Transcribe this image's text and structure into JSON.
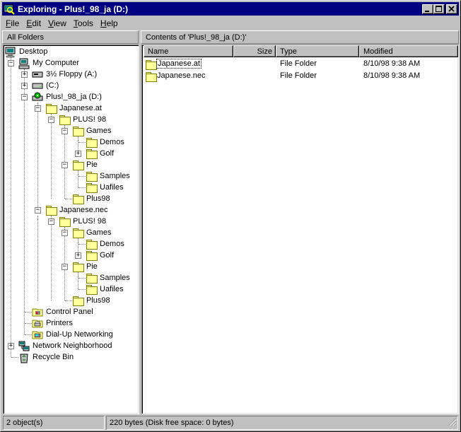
{
  "window": {
    "title": "Exploring - Plus!_98_ja (D:)",
    "accent_color": "#000080"
  },
  "menubar": {
    "items": [
      {
        "underline": "F",
        "rest": "ile"
      },
      {
        "underline": "E",
        "rest": "dit"
      },
      {
        "underline": "V",
        "rest": "iew"
      },
      {
        "underline": "T",
        "rest": "ools"
      },
      {
        "underline": "H",
        "rest": "elp"
      }
    ]
  },
  "left_pane": {
    "header": "All Folders",
    "tree": [
      {
        "label": "Desktop",
        "icon": "desktop-icon"
      },
      {
        "label": "My Computer",
        "icon": "computer-icon"
      },
      {
        "label": "3½ Floppy (A:)",
        "icon": "floppy-icon"
      },
      {
        "label": "(C:)",
        "icon": "drive-icon"
      },
      {
        "label": "Plus!_98_ja (D:)",
        "icon": "cdrom-icon"
      },
      {
        "label": "Japanese.at",
        "icon": "folder-icon"
      },
      {
        "label": "PLUS! 98",
        "icon": "folder-icon"
      },
      {
        "label": "Games",
        "icon": "folder-icon"
      },
      {
        "label": "Demos",
        "icon": "folder-icon"
      },
      {
        "label": "Golf",
        "icon": "folder-icon"
      },
      {
        "label": "Pie",
        "icon": "folder-icon"
      },
      {
        "label": "Samples",
        "icon": "folder-icon"
      },
      {
        "label": "Uafiles",
        "icon": "folder-icon"
      },
      {
        "label": "Plus98",
        "icon": "folder-icon"
      },
      {
        "label": "Japanese.nec",
        "icon": "folder-icon"
      },
      {
        "label": "PLUS! 98",
        "icon": "folder-icon"
      },
      {
        "label": "Games",
        "icon": "folder-icon"
      },
      {
        "label": "Demos",
        "icon": "folder-icon"
      },
      {
        "label": "Golf",
        "icon": "folder-icon"
      },
      {
        "label": "Pie",
        "icon": "folder-icon"
      },
      {
        "label": "Samples",
        "icon": "folder-icon"
      },
      {
        "label": "Uafiles",
        "icon": "folder-icon"
      },
      {
        "label": "Plus98",
        "icon": "folder-icon"
      },
      {
        "label": "Control Panel",
        "icon": "control-panel-icon"
      },
      {
        "label": "Printers",
        "icon": "printers-icon"
      },
      {
        "label": "Dial-Up Networking",
        "icon": "dialup-icon"
      },
      {
        "label": "Network Neighborhood",
        "icon": "network-icon"
      },
      {
        "label": "Recycle Bin",
        "icon": "recycle-bin-icon"
      }
    ]
  },
  "right_pane": {
    "header": "Contents of 'Plus!_98_ja (D:)'",
    "columns": [
      "Name",
      "Size",
      "Type",
      "Modified"
    ],
    "rows": [
      {
        "name": "Japanese.at",
        "size": "",
        "type": "File Folder",
        "modified": "8/10/98 9:38 AM"
      },
      {
        "name": "Japanese.nec",
        "size": "",
        "type": "File Folder",
        "modified": "8/10/98 9:38 AM"
      }
    ]
  },
  "statusbar": {
    "objects": "2 object(s)",
    "info": "220 bytes (Disk free space: 0 bytes)"
  }
}
